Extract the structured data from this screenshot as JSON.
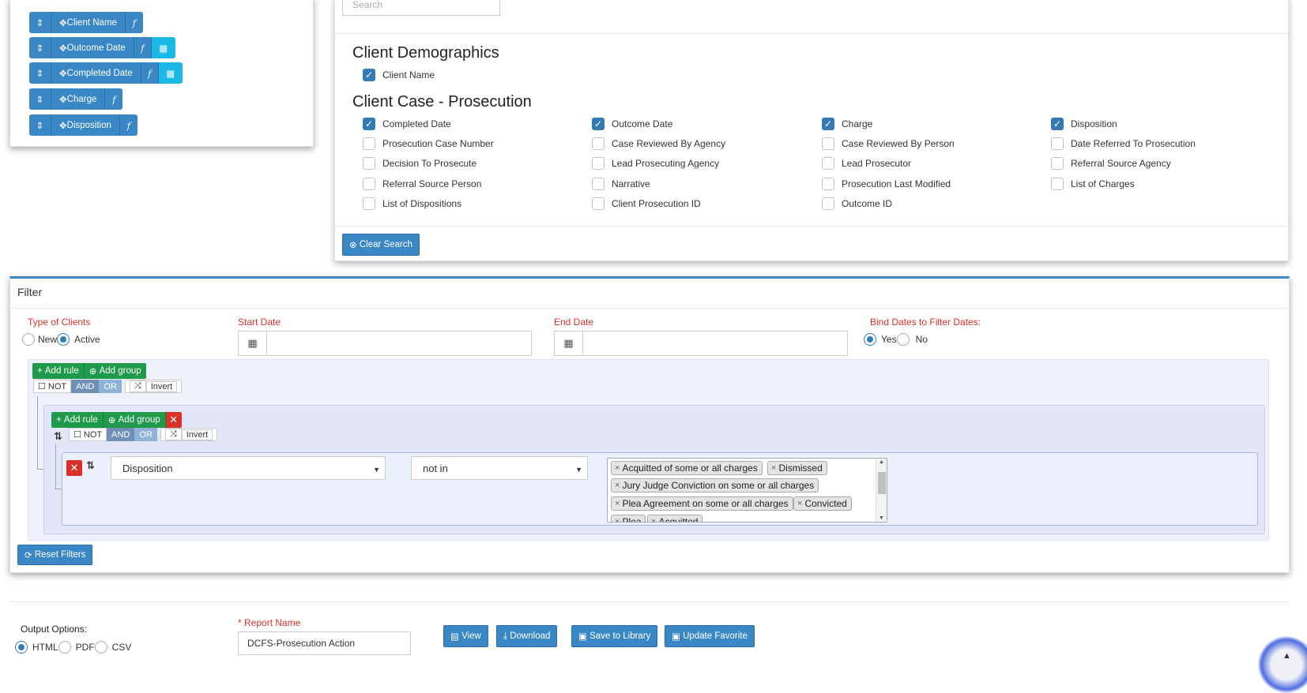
{
  "selected_columns": [
    {
      "name": "Client Name",
      "has_calendar": false
    },
    {
      "name": "Outcome Date",
      "has_calendar": true
    },
    {
      "name": "Completed Date",
      "has_calendar": true
    },
    {
      "name": "Charge",
      "has_calendar": false
    },
    {
      "name": "Disposition",
      "has_calendar": false
    }
  ],
  "column_picker": {
    "search_placeholder": "Search",
    "sections": [
      {
        "title": "Client Demographics",
        "fields": [
          {
            "label": "Client Name",
            "checked": true
          }
        ]
      },
      {
        "title": "Client Case - Prosecution",
        "fields": [
          {
            "label": "Completed Date",
            "checked": true
          },
          {
            "label": "Outcome Date",
            "checked": true
          },
          {
            "label": "Charge",
            "checked": true
          },
          {
            "label": "Disposition",
            "checked": true
          },
          {
            "label": "Prosecution Case Number",
            "checked": false
          },
          {
            "label": "Case Reviewed By Agency",
            "checked": false
          },
          {
            "label": "Case Reviewed By Person",
            "checked": false
          },
          {
            "label": "Date Referred To Prosecution",
            "checked": false
          },
          {
            "label": "Decision To Prosecute",
            "checked": false
          },
          {
            "label": "Lead Prosecuting Agency",
            "checked": false
          },
          {
            "label": "Lead Prosecutor",
            "checked": false
          },
          {
            "label": "Referral Source Agency",
            "checked": false
          },
          {
            "label": "Referral Source Person",
            "checked": false
          },
          {
            "label": "Narrative",
            "checked": false
          },
          {
            "label": "Prosecution Last Modified",
            "checked": false
          },
          {
            "label": "List of Charges",
            "checked": false
          },
          {
            "label": "List of Dispositions",
            "checked": false
          },
          {
            "label": "Client Prosecution ID",
            "checked": false
          },
          {
            "label": "Outcome ID",
            "checked": false
          }
        ]
      }
    ],
    "clear_search_label": "Clear Search"
  },
  "filter": {
    "title": "Filter",
    "type_of_clients": {
      "label": "Type of Clients",
      "options": [
        "New",
        "Active"
      ],
      "selected": "Active"
    },
    "start_date": {
      "label": "Start Date",
      "value": ""
    },
    "end_date": {
      "label": "End Date",
      "value": ""
    },
    "bind_dates": {
      "label": "Bind Dates to Filter Dates:",
      "options": [
        "Yes",
        "No"
      ],
      "selected": "Yes"
    },
    "query_builder": {
      "add_rule_label": "Add rule",
      "add_group_label": "Add group",
      "not_label": "NOT",
      "and_label": "AND",
      "or_label": "OR",
      "invert_label": "Invert",
      "rule": {
        "field": "Disposition",
        "operator": "not in",
        "values": [
          "Acquitted of some or all charges",
          "Dismissed",
          "Jury Judge Conviction on some or all charges",
          "Plea Agreement on some or all charges",
          "Convicted",
          "Plea",
          "Acquitted"
        ]
      }
    },
    "reset_label": "Reset Filters"
  },
  "output": {
    "label": "Output Options:",
    "formats": [
      "HTML",
      "PDF",
      "CSV"
    ],
    "selected_format": "HTML",
    "report_name_label": "* Report Name",
    "report_name_value": "DCFS-Prosecution Action",
    "buttons": {
      "view": "View",
      "download": "Download",
      "save": "Save to Library",
      "update": "Update Favorite"
    }
  },
  "colors": {
    "primary": "#3a87c5",
    "info": "#19b8e6",
    "success": "#1e9a4a",
    "danger": "#d9302b",
    "label_red": "#d9302b"
  },
  "icons": [
    "sort-icon",
    "move-icon",
    "function-icon",
    "calendar-icon",
    "times-circle-icon",
    "plus-icon",
    "plus-circle-icon",
    "random-icon",
    "refresh-icon",
    "file-icon",
    "download-icon",
    "save-icon",
    "chevron-up-icon"
  ]
}
